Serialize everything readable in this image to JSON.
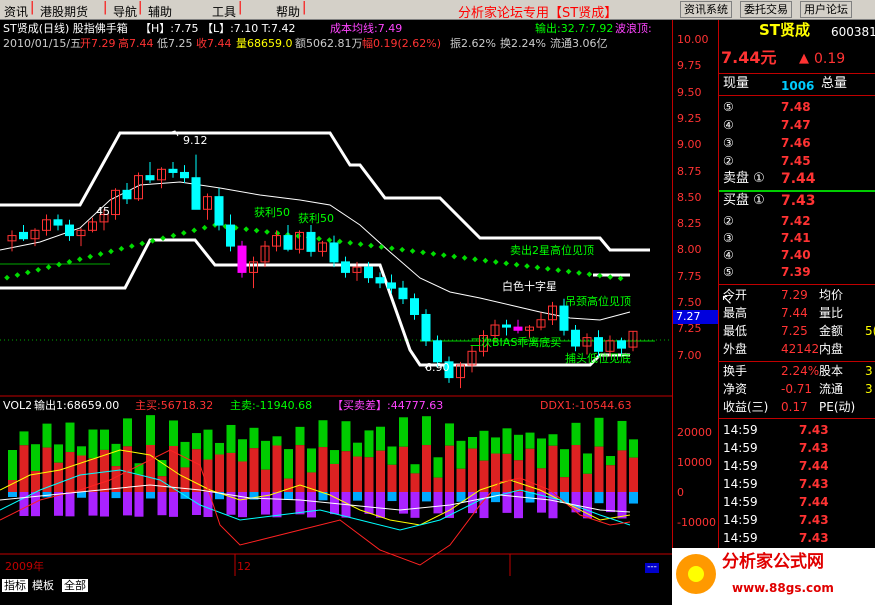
{
  "menu": {
    "items": [
      "资讯",
      "港股期货",
      "导航",
      "辅助",
      "工具",
      "帮助"
    ],
    "center_title": "分析家论坛专用【ST贤成】",
    "buttons": [
      "资讯系统",
      "委托交易",
      "用户论坛"
    ]
  },
  "header": {
    "line1_name": "ST贤成(日线) 股指佛手箱",
    "line1_hl": "【H】:7.75 【L】:7.10 T:7.42",
    "line1_cost": "成本均线:7.49",
    "line1_out": "输出:32.7:7.92",
    "line1_wave": "波浪顶:",
    "line2_date": "2010/01/15/五",
    "line2_open": "开7.29",
    "line2_high": "高7.44",
    "line2_low": "低7.25",
    "line2_close": "收7.44",
    "line2_vol": "量68659.0",
    "line2_amt": "额5062.81万",
    "line2_pct": "幅0.19(2.62%)",
    "line2_amp": "振2.62%",
    "line2_turn": "换2.24%",
    "line2_float": "流通3.06亿"
  },
  "chart_labels": {
    "peak": "9.12",
    "trough": "6.90",
    "left_low": "45",
    "profit1": "获利50",
    "profit2": "获利50",
    "sell_star": "卖出2星高位见顶",
    "white_star": "白色十字星",
    "neck_top": "吊颈高位见顶",
    "bias_buy": "二次BIAS乖离底买",
    "catch_bottom": "捕头低位见底",
    "price_tag": "7.27"
  },
  "indicator": {
    "name": "VOL2",
    "output": "输出1:68659.00",
    "main_buy_label": "主买:56718.32",
    "main_sell_label": "主卖:-11940.68",
    "diff_label": "【买卖差】:44777.63",
    "ddx_label": "DDX1:-10544.63",
    "x_year": "2009年",
    "x_12": "12"
  },
  "price_axis": [
    "10.00",
    "9.75",
    "9.50",
    "9.25",
    "9.00",
    "8.75",
    "8.50",
    "8.25",
    "8.00",
    "7.75",
    "7.50",
    "7.25",
    "7.00"
  ],
  "vol_axis": [
    "20000",
    "10000",
    "0",
    "-10000"
  ],
  "panel": {
    "stock_name": "ST贤成",
    "code": "600381",
    "price": "7.44元",
    "change": "0.19",
    "now_hand_label": "现量",
    "now_hand": "1006",
    "total_label": "总量",
    "asks": [
      {
        "lvl": "⑤",
        "p": "7.48"
      },
      {
        "lvl": "④",
        "p": "7.47"
      },
      {
        "lvl": "③",
        "p": "7.46"
      },
      {
        "lvl": "②",
        "p": "7.45"
      }
    ],
    "ask1_label": "卖盘 ①",
    "ask1": "7.44",
    "bid1_label": "买盘 ①",
    "bid1": "7.43",
    "bids": [
      {
        "lvl": "②",
        "p": "7.42"
      },
      {
        "lvl": "③",
        "p": "7.41"
      },
      {
        "lvl": "④",
        "p": "7.40"
      },
      {
        "lvl": "⑤",
        "p": "7.39"
      }
    ],
    "stats": [
      {
        "k": "今开",
        "v": "7.29",
        "k2": "均价",
        "v2": ""
      },
      {
        "k": "最高",
        "v": "7.44",
        "k2": "量比",
        "v2": ""
      },
      {
        "k": "最低",
        "v": "7.25",
        "k2": "金额",
        "v2": "5("
      },
      {
        "k": "外盘",
        "v": "42142",
        "k2": "内盘",
        "v2": ""
      }
    ],
    "stats2": [
      {
        "k": "换手",
        "v": "2.24%",
        "k2": "股本",
        "v2": "3"
      },
      {
        "k": "净资",
        "v": "-0.71",
        "k2": "流通",
        "v2": "3"
      },
      {
        "k": "收益(三)",
        "v": "0.17",
        "k2": "PE(动)",
        "v2": ""
      }
    ],
    "ticks": [
      {
        "t": "14:59",
        "p": "7.43"
      },
      {
        "t": "14:59",
        "p": "7.43"
      },
      {
        "t": "14:59",
        "p": "7.44"
      },
      {
        "t": "14:59",
        "p": "7.43"
      },
      {
        "t": "14:59",
        "p": "7.44"
      },
      {
        "t": "14:59",
        "p": "7.43"
      },
      {
        "t": "14:59",
        "p": "7.43"
      }
    ]
  },
  "tabs": [
    "指标",
    "模板",
    "全部"
  ],
  "logo": {
    "title": "分析家公式网",
    "url": "www.88gs.com"
  },
  "colors": {
    "up": "#ff3333",
    "down": "#00ffff",
    "green": "#00ff00",
    "yellow": "#ffff00",
    "magenta": "#ff00ff"
  }
}
